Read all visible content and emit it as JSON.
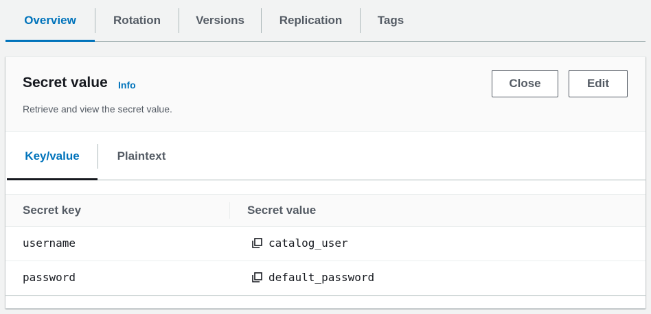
{
  "top_tabs": [
    {
      "label": "Overview",
      "active": true
    },
    {
      "label": "Rotation",
      "active": false
    },
    {
      "label": "Versions",
      "active": false
    },
    {
      "label": "Replication",
      "active": false
    },
    {
      "label": "Tags",
      "active": false
    }
  ],
  "panel": {
    "title": "Secret value",
    "info_label": "Info",
    "description": "Retrieve and view the secret value.",
    "close_label": "Close",
    "edit_label": "Edit"
  },
  "inner_tabs": [
    {
      "label": "Key/value",
      "active": true
    },
    {
      "label": "Plaintext",
      "active": false
    }
  ],
  "table": {
    "headers": {
      "key": "Secret key",
      "value": "Secret value"
    },
    "rows": [
      {
        "key": "username",
        "value": "catalog_user"
      },
      {
        "key": "password",
        "value": "default_password"
      }
    ]
  },
  "colors": {
    "accent": "#0073bb",
    "text": "#16191f",
    "muted": "#545b64"
  },
  "icons": {
    "copy": "copy-icon"
  }
}
